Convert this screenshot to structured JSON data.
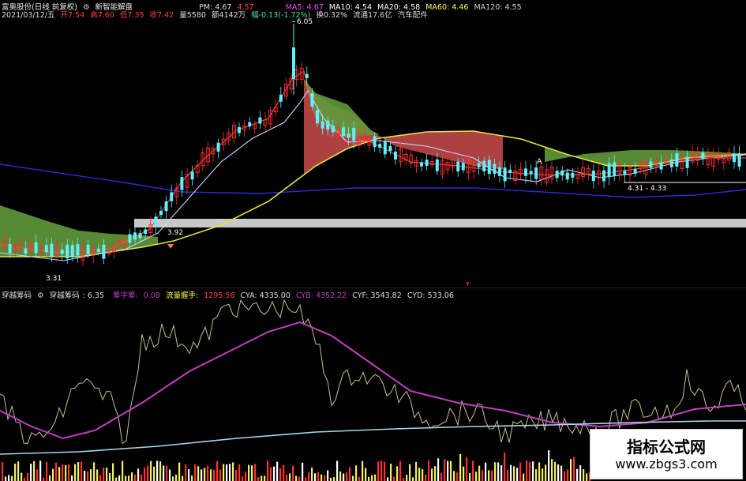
{
  "header": {
    "stock": "富奥股份(日线 前复权)",
    "indicator_name": "新智能解盘",
    "pm": "PM: 4.67",
    "price_top": "4.57",
    "ma5": "MA5: 4.67",
    "ma10": "MA10: 4.54",
    "ma20": "MA20: 4.58",
    "ma60": "MA60: 4.46",
    "ma120": "MA120: 4.55",
    "date": "2021/03/12/五",
    "open": "开7.54",
    "high": "高7.60",
    "low": "低7.35",
    "close": "收7.42",
    "volume": "量5580",
    "amount": "额4142万",
    "change": "幅-0.13(-1.72%)",
    "turnover": "换0.32%",
    "float": "流通17.6亿",
    "sector": "汽车配件"
  },
  "price_labels": {
    "high": "6.05",
    "low_left": "3.31",
    "mid_left": "3.92",
    "range_right": "4.31 - 4.33",
    "marker_a": "A"
  },
  "indicator": {
    "name": "穿越筹码",
    "value": "6.35",
    "lock_label": "筹字筹:",
    "lock_value": "0.08",
    "volume_label": "流量握手:",
    "volume_value": "1295.56",
    "cya": "CYA: 4335.00",
    "cyb": "CYB: 4352.22",
    "cyf": "CYF: 3543.82",
    "cyd": "CYD: 533.06"
  },
  "colors": {
    "up": "#ff3030",
    "down": "#5ff0ff",
    "ma_white": "#ffffff",
    "ma_yellow": "#e8e23a",
    "ma_blue": "#2b2bd6",
    "ribbon_red": "#c04848",
    "ribbon_green": "#5f9a3a",
    "osc_line": "#c8c08a",
    "osc_magenta": "#c040c0",
    "osc_cyan": "#a8d8e8"
  },
  "watermark": {
    "title": "指标公式网",
    "url": "www.zbgs3.com"
  }
}
